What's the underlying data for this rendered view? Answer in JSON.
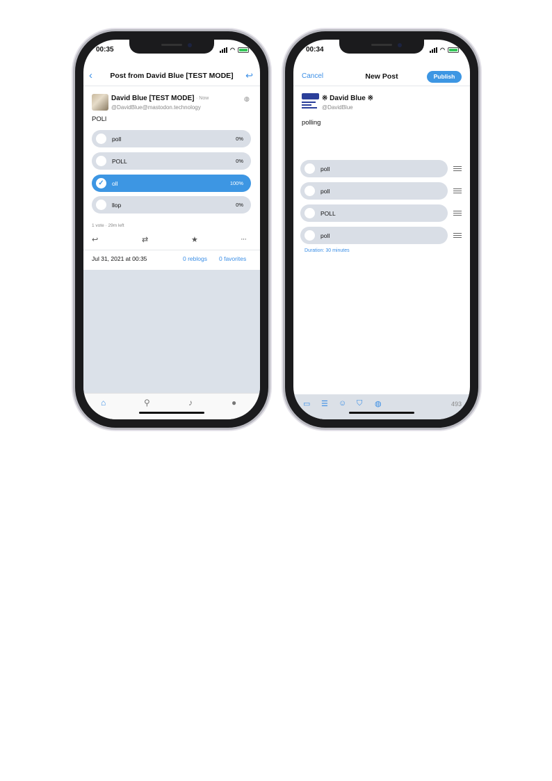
{
  "left_phone": {
    "status_time": "00:35",
    "nav": {
      "back_icon": "chevron-left-icon",
      "title": "Post from David Blue [TEST MODE]",
      "reply_icon": "reply-icon"
    },
    "post": {
      "author": "David Blue [TEST MODE]",
      "time": "· Now",
      "handle": "@DavidBlue@mastodon.technology",
      "content": "POLl",
      "poll": [
        {
          "label": "poll",
          "pct": "0%",
          "selected": false
        },
        {
          "label": "POLL",
          "pct": "0%",
          "selected": false
        },
        {
          "label": "oll",
          "pct": "100%",
          "selected": true
        },
        {
          "label": "llop",
          "pct": "0%",
          "selected": false
        }
      ],
      "poll_meta": "1 vote · 29m left",
      "date": "Jul 31, 2021 at 00:35",
      "reblogs": "0 reblogs",
      "favorites": "0 favorites"
    },
    "actions": [
      "reply-icon",
      "boost-icon",
      "star-icon",
      "more-icon"
    ],
    "tabs": [
      "home-icon",
      "search-icon",
      "bell-icon",
      "profile-icon"
    ]
  },
  "right_phone": {
    "status_time": "00:34",
    "cancel": "Cancel",
    "title": "New Post",
    "publish": "Publish",
    "author": "※ David Blue ※",
    "handle": "@DavidBlue",
    "text": "polling",
    "poll": [
      "poll",
      "poll",
      "POLL",
      "poll"
    ],
    "duration": "Duration: 30 minutes",
    "char_count": "493",
    "toolbar_icons": [
      "image-icon",
      "list-icon",
      "emoji-icon",
      "shield-icon",
      "globe-icon"
    ]
  }
}
